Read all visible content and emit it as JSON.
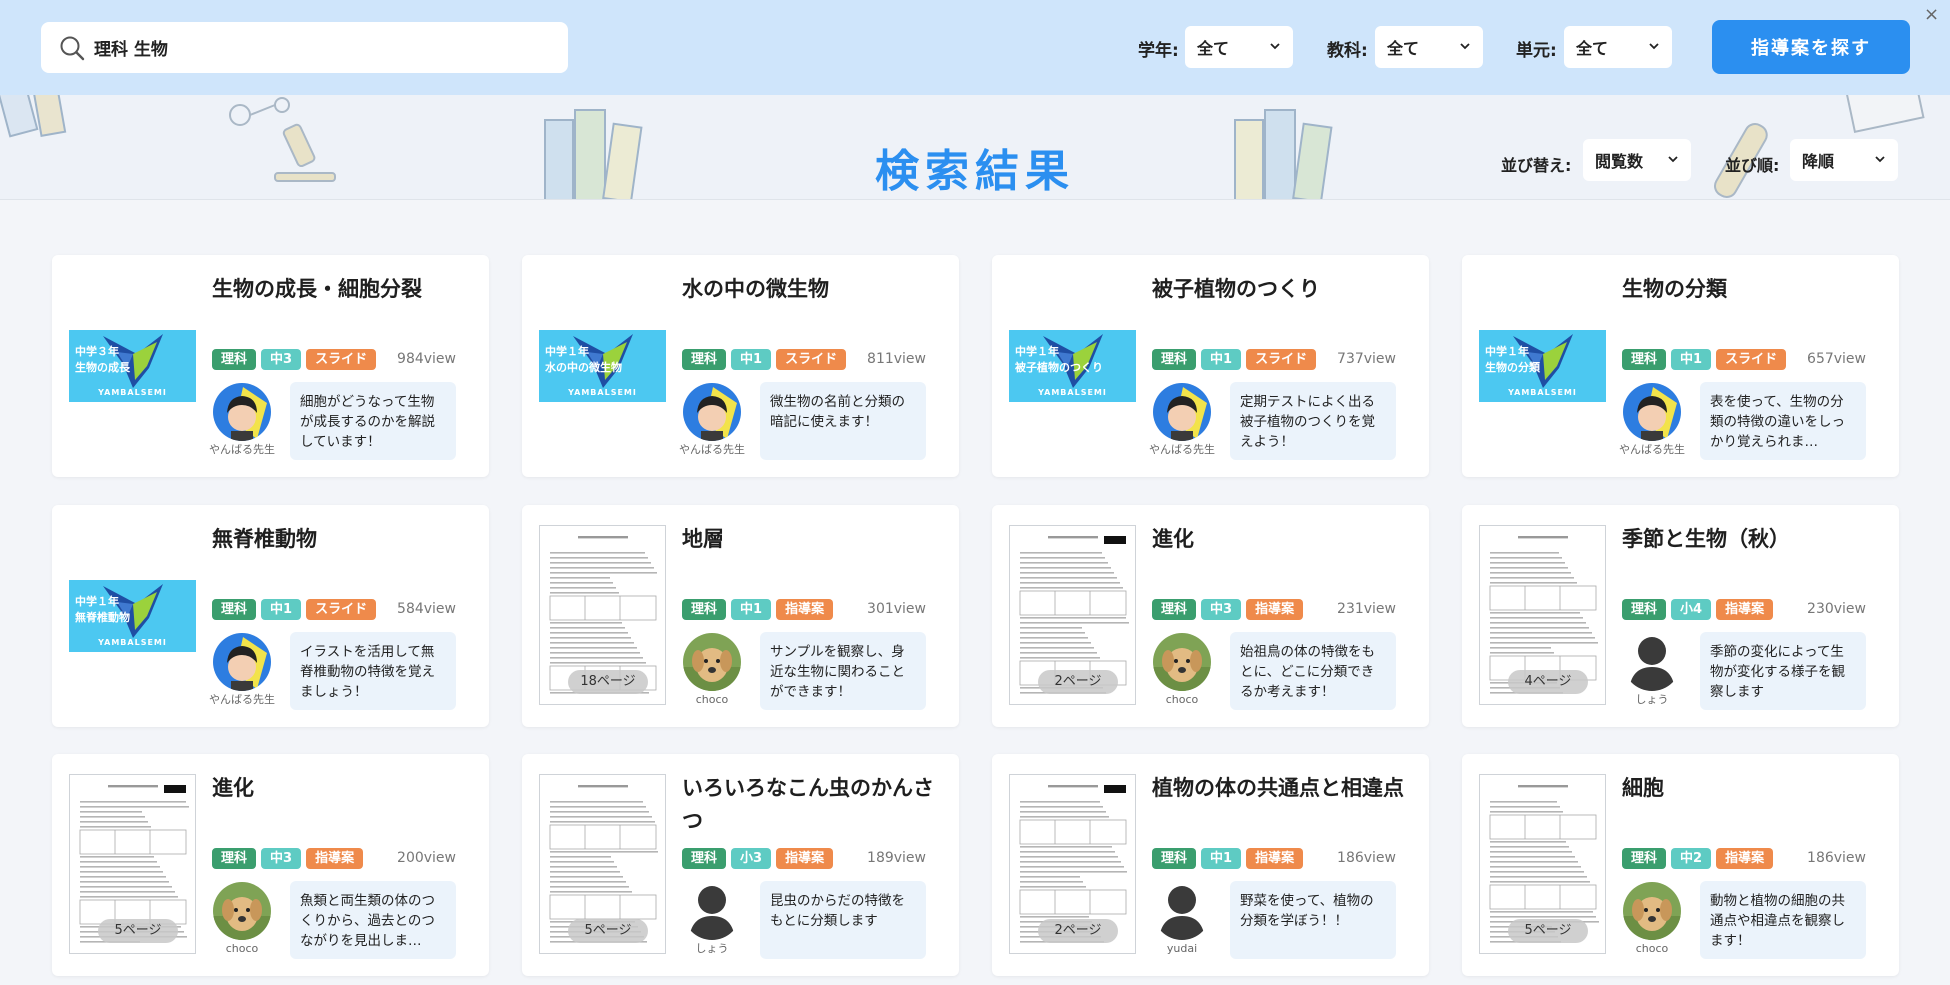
{
  "search": {
    "value": "理科 生物",
    "placeholder": ""
  },
  "filters": [
    {
      "label": "学年:",
      "value": "全て"
    },
    {
      "label": "教科:",
      "value": "全て"
    },
    {
      "label": "単元:",
      "value": "全て"
    }
  ],
  "find_button": "指導案を探す",
  "close_label": "×",
  "results_title": "検索結果",
  "sort": {
    "by_label": "並び替え:",
    "by_value": "閲覧数",
    "order_label": "並び順:",
    "order_value": "降順"
  },
  "cards": [
    {
      "title": "生物の成長・細胞分裂",
      "thumb": "slide",
      "slide_line1": "中学３年",
      "slide_line2": "生物の成長",
      "brand": "YAMBALSEMI",
      "subject": "理科",
      "grade": "中3",
      "type": "スライド",
      "views": "984view",
      "author": "やんばる先生",
      "avatar": "teacher",
      "desc": "細胞がどうなって生物が成長するのかを解説しています！"
    },
    {
      "title": "水の中の微生物",
      "thumb": "slide",
      "slide_line1": "中学１年",
      "slide_line2": "水の中の微生物",
      "brand": "YAMBALSEMI",
      "subject": "理科",
      "grade": "中1",
      "type": "スライド",
      "views": "811view",
      "author": "やんばる先生",
      "avatar": "teacher",
      "desc": "微生物の名前と分類の暗記に使えます！"
    },
    {
      "title": "被子植物のつくり",
      "thumb": "slide",
      "slide_line1": "中学１年",
      "slide_line2": "被子植物のつくり",
      "brand": "YAMBALSEMI",
      "subject": "理科",
      "grade": "中1",
      "type": "スライド",
      "views": "737view",
      "author": "やんばる先生",
      "avatar": "teacher",
      "desc": "定期テストによく出る被子植物のつくりを覚えよう！"
    },
    {
      "title": "生物の分類",
      "thumb": "slide",
      "slide_line1": "中学１年",
      "slide_line2": "生物の分類",
      "brand": "YAMBALSEMI",
      "subject": "理科",
      "grade": "中1",
      "type": "スライド",
      "views": "657view",
      "author": "やんばる先生",
      "avatar": "teacher",
      "desc": "表を使って、生物の分類の特徴の違いをしっかり覚えられま…"
    },
    {
      "title": "無脊椎動物",
      "thumb": "slide",
      "slide_line1": "中学１年",
      "slide_line2": "無脊椎動物",
      "brand": "YAMBALSEMI",
      "subject": "理科",
      "grade": "中1",
      "type": "スライド",
      "views": "584view",
      "author": "やんばる先生",
      "avatar": "teacher",
      "desc": "イラストを活用して無脊椎動物の特徴を覚えましょう！"
    },
    {
      "title": "地層",
      "thumb": "doc",
      "pages": "18ページ",
      "subject": "理科",
      "grade": "中1",
      "type": "指導案",
      "views": "301view",
      "author": "choco",
      "avatar": "dog",
      "desc": "サンプルを観察し、身近な生物に関わることができます！"
    },
    {
      "title": "進化",
      "thumb": "doc",
      "pages": "2ページ",
      "subject": "理科",
      "grade": "中3",
      "type": "指導案",
      "views": "231view",
      "author": "choco",
      "avatar": "dog",
      "desc": "始祖鳥の体の特徴をもとに、どこに分類できるか考えます！"
    },
    {
      "title": "季節と生物（秋）",
      "thumb": "doc",
      "pages": "4ページ",
      "subject": "理科",
      "grade": "小4",
      "type": "指導案",
      "views": "230view",
      "author": "しょう",
      "avatar": "person",
      "desc": "季節の変化によって生物が変化する様子を観察します"
    },
    {
      "title": "進化",
      "thumb": "doc",
      "pages": "5ページ",
      "subject": "理科",
      "grade": "中3",
      "type": "指導案",
      "views": "200view",
      "author": "choco",
      "avatar": "dog",
      "desc": "魚類と両生類の体のつくりから、過去とのつながりを見出しま…"
    },
    {
      "title": "いろいろなこん虫のかんさつ",
      "thumb": "doc",
      "pages": "5ページ",
      "subject": "理科",
      "grade": "小3",
      "type": "指導案",
      "views": "189view",
      "author": "しょう",
      "avatar": "person",
      "desc": "昆虫のからだの特徴をもとに分類します"
    },
    {
      "title": "植物の体の共通点と相違点",
      "thumb": "doc",
      "pages": "2ページ",
      "subject": "理科",
      "grade": "中1",
      "type": "指導案",
      "views": "186view",
      "author": "yudai",
      "avatar": "person",
      "desc": "野菜を使って、植物の分類を学ぼう！！"
    },
    {
      "title": "細胞",
      "thumb": "doc",
      "pages": "5ページ",
      "subject": "理科",
      "grade": "中2",
      "type": "指導案",
      "views": "186view",
      "author": "choco",
      "avatar": "dog",
      "desc": "動物と植物の細胞の共通点や相違点を観察します！"
    }
  ]
}
